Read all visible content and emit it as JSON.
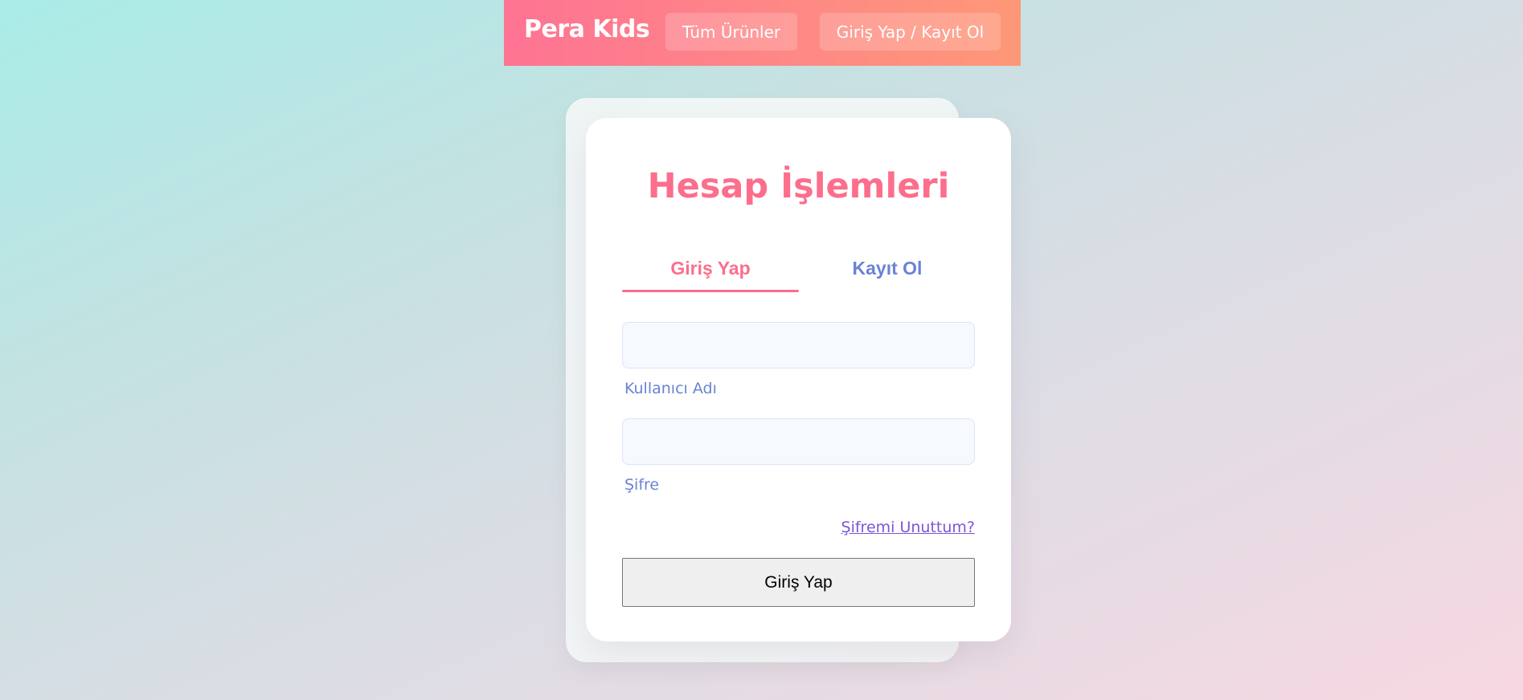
{
  "header": {
    "brand": "Pera Kids",
    "nav": {
      "products_label": "Tüm Ürünler",
      "login_label": "Giriş Yap / Kayıt Ol"
    }
  },
  "card": {
    "title": "Hesap İşlemleri",
    "tabs": [
      {
        "label": "Giriş Yap",
        "active": true
      },
      {
        "label": "Kayıt Ol",
        "active": false
      }
    ],
    "form": {
      "username": {
        "label": "Kullanıcı Adı",
        "value": ""
      },
      "password": {
        "label": "Şifre",
        "value": ""
      },
      "forgot_link": "Şifremi Unuttum?",
      "submit_label": "Giriş Yap"
    }
  },
  "colors": {
    "accent_pink": "#fc6e8c",
    "accent_blue": "#6983d4",
    "link_purple": "#7b55d8",
    "header_start": "#fe7393",
    "header_end": "#fe9777"
  }
}
